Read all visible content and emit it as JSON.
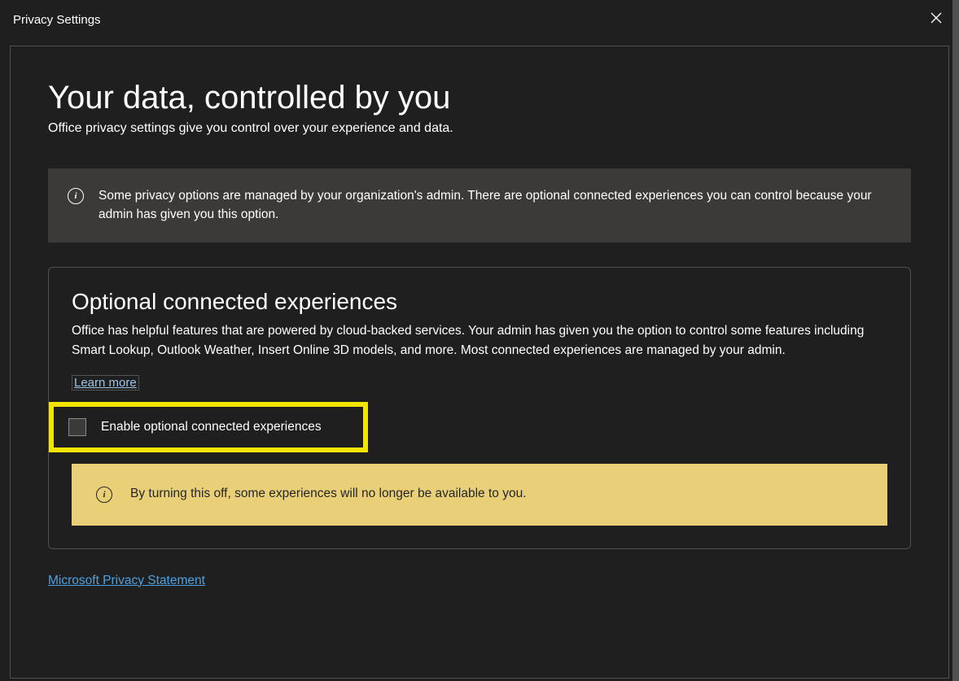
{
  "titlebar": {
    "title": "Privacy Settings"
  },
  "main": {
    "heading": "Your data, controlled by you",
    "subheading": "Office privacy settings give you control over your experience and data.",
    "admin_info": "Some privacy options are managed by your organization's admin. There are optional connected experiences you can control because your admin has given you this option."
  },
  "section": {
    "title": "Optional connected experiences",
    "description": "Office has helpful features that are powered by cloud-backed services. Your admin has given you the option to control some features including Smart Lookup, Outlook Weather, Insert Online 3D models, and more. Most connected experiences are managed by your admin.",
    "learn_more": "Learn more",
    "checkbox_label": "Enable optional connected experiences",
    "checkbox_checked": false,
    "warning": "By turning this off, some experiences will no longer be available to you."
  },
  "footer": {
    "privacy_statement": "Microsoft Privacy Statement"
  }
}
